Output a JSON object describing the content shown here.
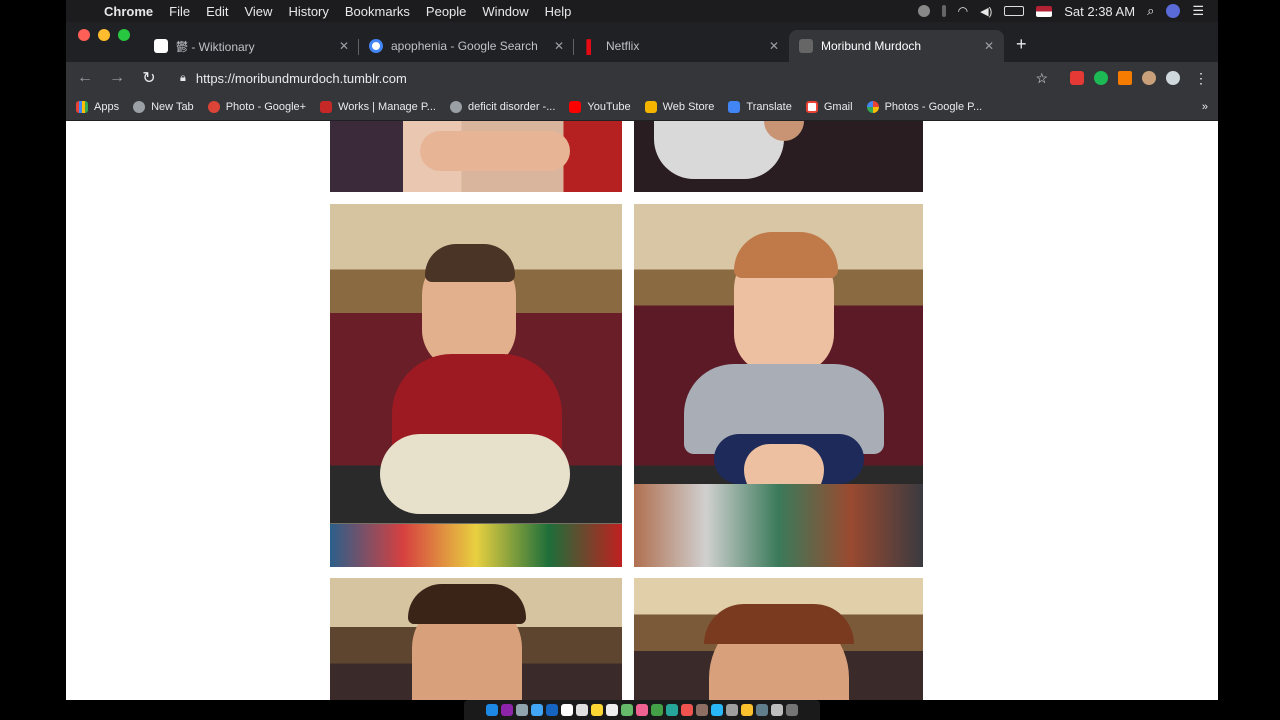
{
  "menubar": {
    "app": "Chrome",
    "items": [
      "File",
      "Edit",
      "View",
      "History",
      "Bookmarks",
      "People",
      "Window",
      "Help"
    ],
    "clock": "Sat 2:38 AM"
  },
  "tabs": [
    {
      "title": "鬱 - Wiktionary",
      "favicon": "W",
      "color": "#ffffff",
      "active": false
    },
    {
      "title": "apophenia - Google Search",
      "favicon": "G",
      "color": "#4285f4",
      "active": false
    },
    {
      "title": "Netflix",
      "favicon": "N",
      "color": "#e50914",
      "active": false
    },
    {
      "title": "Moribund Murdoch",
      "favicon": "M",
      "color": "#777777",
      "active": true
    }
  ],
  "toolbar": {
    "url": "https://moribundmurdoch.tumblr.com"
  },
  "bookmarks": [
    {
      "label": "Apps",
      "color": "#ea4335"
    },
    {
      "label": "New Tab",
      "color": "#9aa0a6"
    },
    {
      "label": "Photo - Google+",
      "color": "#db4437"
    },
    {
      "label": "Works | Manage P...",
      "color": "#c62828"
    },
    {
      "label": "deficit disorder -...",
      "color": "#9aa0a6"
    },
    {
      "label": "YouTube",
      "color": "#ff0000"
    },
    {
      "label": "Web Store",
      "color": "#f4b400"
    },
    {
      "label": "Translate",
      "color": "#4285f4"
    },
    {
      "label": "Gmail",
      "color": "#ea4335"
    },
    {
      "label": "Photos - Google P...",
      "color": "#fbbc05"
    }
  ],
  "colors": {
    "menubar": "#1c1c1e",
    "tabstrip": "#202124",
    "toolbar": "#35363a",
    "page": "#ffffff"
  }
}
